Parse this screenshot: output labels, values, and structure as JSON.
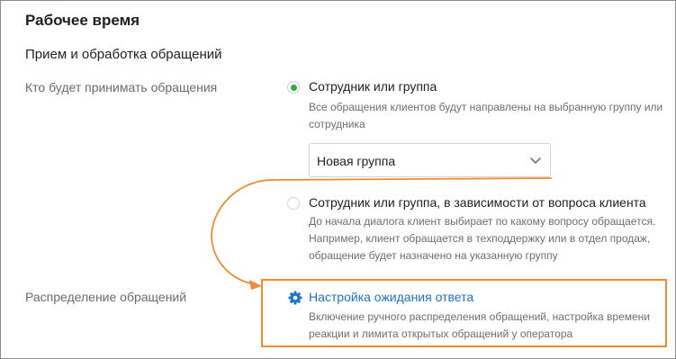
{
  "section": {
    "title": "Рабочее время",
    "subtitle": "Прием и обработка обращений"
  },
  "routing": {
    "label": "Кто будет принимать обращения",
    "options": [
      {
        "title": "Сотрудник или группа",
        "description_lines": [
          "Все обращения клиентов будут направлены на выбранную группу или",
          "сотрудника"
        ],
        "selected": true
      },
      {
        "title": "Сотрудник или группа, в зависимости от вопроса клиента",
        "description_lines": [
          "До начала диалога клиент выбирает по какому вопросу обращается.",
          "Например, клиент обращается в техподдержку или в отдел продаж,",
          "обращение будет назначено на указанную группу"
        ],
        "selected": false
      }
    ],
    "group_select": {
      "value": "Новая группа"
    }
  },
  "distribution": {
    "label": "Распределение обращений",
    "link": {
      "icon": "gear-icon",
      "label": "Настройка ожидания ответа",
      "description_lines": [
        "Включение ручного распределения обращений, настройка времени",
        "реакции и лимита открытых обращений у оператора"
      ]
    }
  },
  "colors": {
    "accent_green": "#2eae3f",
    "link_blue": "#1e74c8",
    "annotation_orange": "#f08a34"
  }
}
